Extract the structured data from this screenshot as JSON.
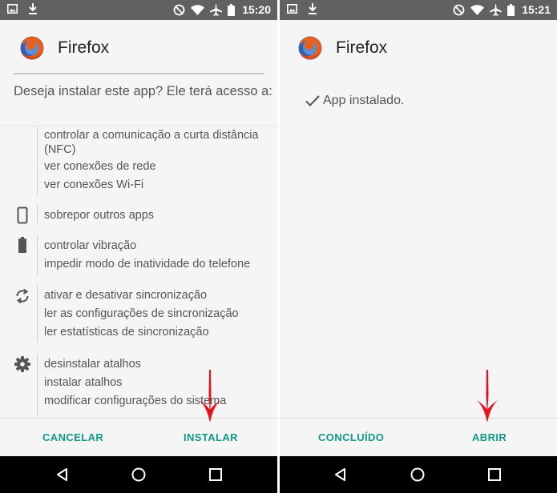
{
  "left": {
    "status": {
      "time": "15:20"
    },
    "app_name": "Firefox",
    "question": "Deseja instalar este app? Ele terá acesso a:",
    "permissions": [
      {
        "icon": "",
        "lines": [
          "controlar a comunicação a curta distância",
          "(NFC)",
          "ver conexões de rede",
          "ver conexões Wi-Fi"
        ]
      },
      {
        "icon": "phone-icon",
        "lines": [
          "sobrepor outros apps"
        ]
      },
      {
        "icon": "battery-icon",
        "lines": [
          "controlar vibração",
          "impedir modo de inatividade do telefone"
        ]
      },
      {
        "icon": "sync-icon",
        "lines": [
          "ativar e desativar sincronização",
          "ler as configurações de sincronização",
          "ler estatísticas de sincronização"
        ]
      },
      {
        "icon": "gear-icon",
        "lines": [
          "desinstalar atalhos",
          "instalar atalhos",
          "modificar configurações do sistema"
        ]
      }
    ],
    "buttons": {
      "cancel": "CANCELAR",
      "install": "INSTALAR"
    }
  },
  "right": {
    "status": {
      "time": "15:21"
    },
    "app_name": "Firefox",
    "installed_text": "App instalado.",
    "buttons": {
      "done": "CONCLUÍDO",
      "open": "ABRIR"
    }
  },
  "colors": {
    "accent": "#11988a",
    "arrow": "#e8101a",
    "status_bar": "#616161",
    "nav_bar": "#000000"
  }
}
